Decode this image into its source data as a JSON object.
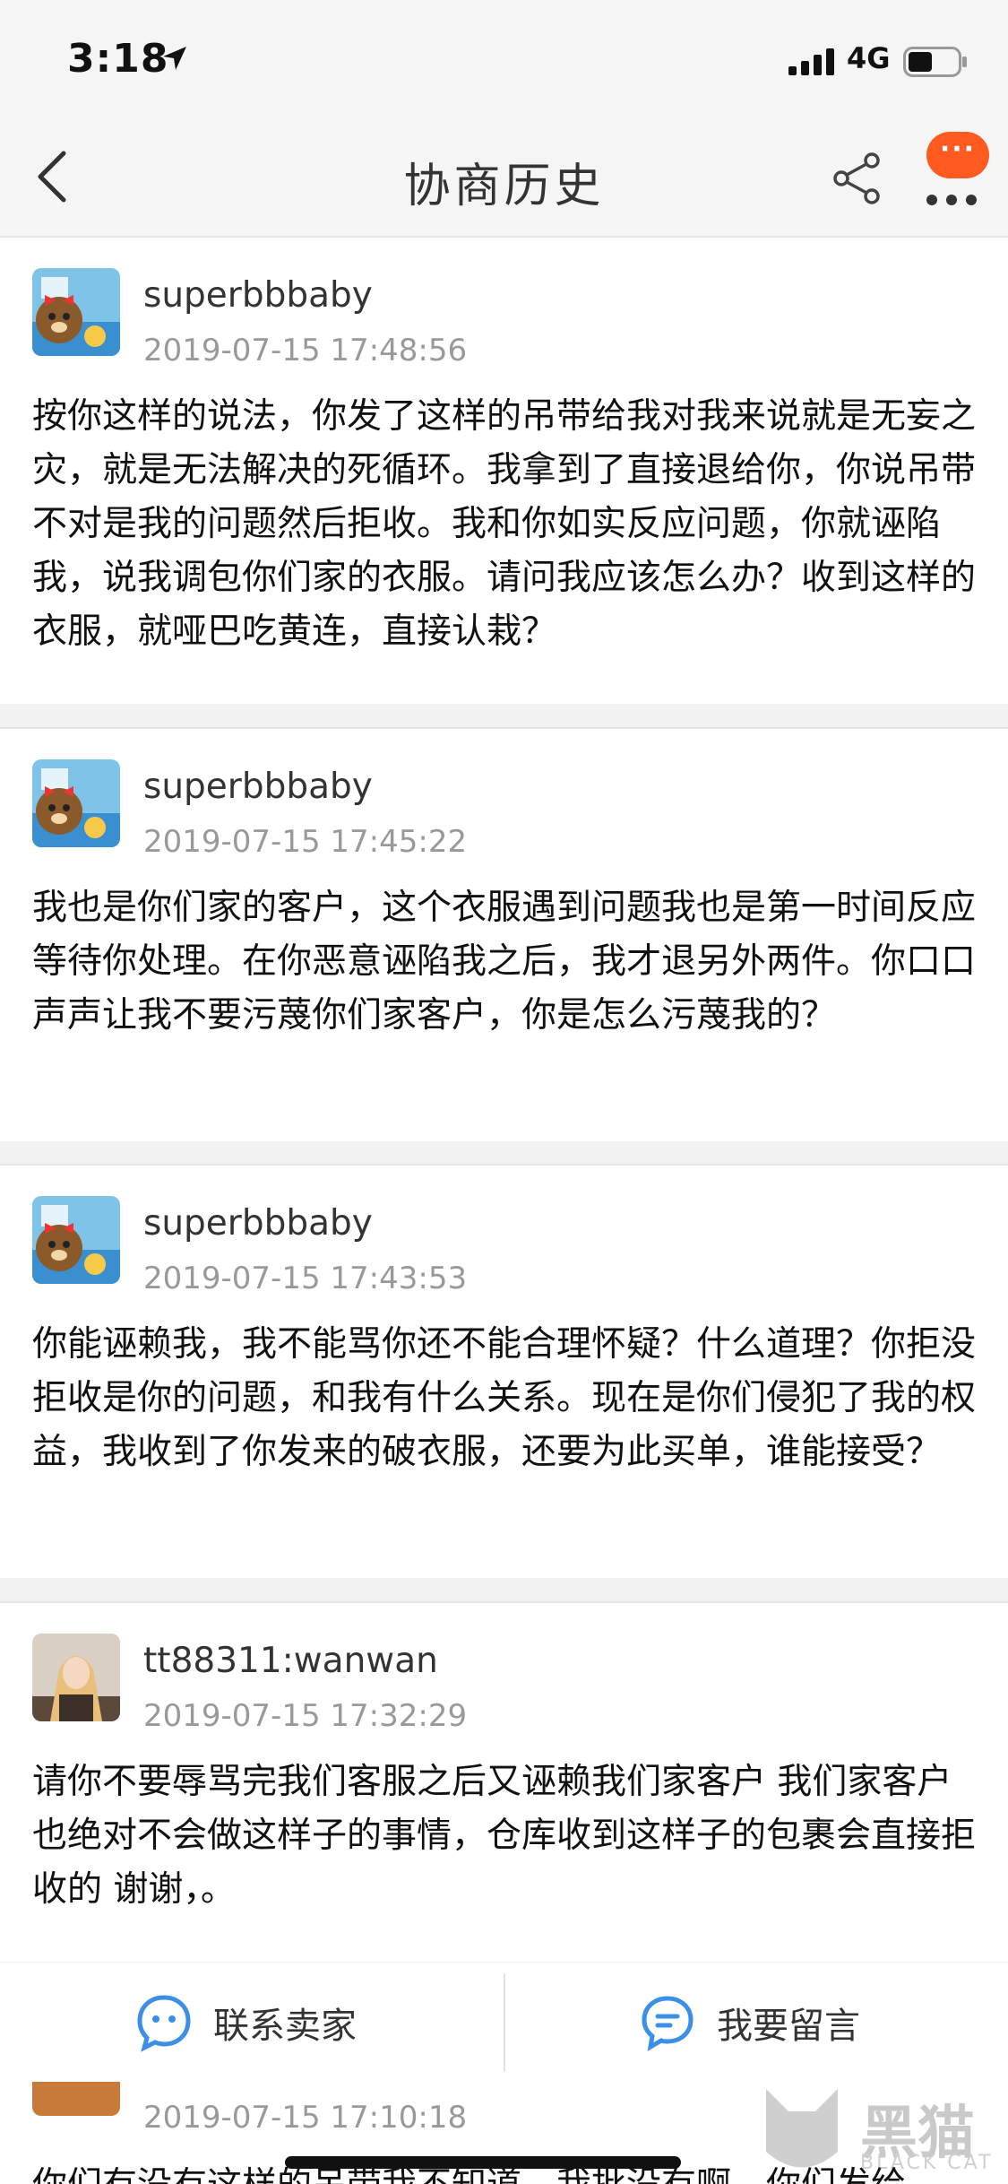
{
  "status_bar": {
    "time": "3:18",
    "network": "4G"
  },
  "nav": {
    "title": "协商历史",
    "badge": "···"
  },
  "messages": [
    {
      "user": "superbbbaby",
      "time": "2019-07-15 17:48:56",
      "text": "按你这样的说法，你发了这样的吊带给我对我来说就是无妄之灾，就是无法解决的死循环。我拿到了直接退给你，你说吊带不对是我的问题然后拒收。我和你如实反应问题，你就诬陷我，说我调包你们家的衣服。请问我应该怎么办？收到这样的衣服，就哑巴吃黄连，直接认栽？"
    },
    {
      "user": "superbbbaby",
      "time": "2019-07-15 17:45:22",
      "text": "我也是你们家的客户，这个衣服遇到问题我也是第一时间反应等待你处理。在你恶意诬陷我之后，我才退另外两件。你口口声声让我不要污蔑你们家客户，你是怎么污蔑我的？"
    },
    {
      "user": "superbbbaby",
      "time": "2019-07-15 17:43:53",
      "text": "你能诬赖我，我不能骂你还不能合理怀疑？什么道理？你拒没拒收是你的问题，和我有什么关系。现在是你们侵犯了我的权益，我收到了你发来的破衣服，还要为此买单，谁能接受？"
    },
    {
      "user": "tt88311:wanwan",
      "time": "2019-07-15 17:32:29",
      "text": "请你不要辱骂完我们客服之后又诬赖我们家客户 我们家客户也绝对不会做这样子的事情，仓库收到这样子的包裹会直接拒收的 谢谢，。"
    }
  ],
  "partial_message": {
    "time": "2019-07-15 17:10:18",
    "text": "你们有没有这样的吊带我不知道，我批没有啊，你们发给"
  },
  "actions": {
    "contact_seller": "联系卖家",
    "leave_message": "我要留言"
  },
  "watermark": {
    "name": "黑猫",
    "sub": "BLACK CAT"
  },
  "colors": {
    "accent": "#ff5a1f",
    "icon_blue": "#3b8fe6"
  }
}
